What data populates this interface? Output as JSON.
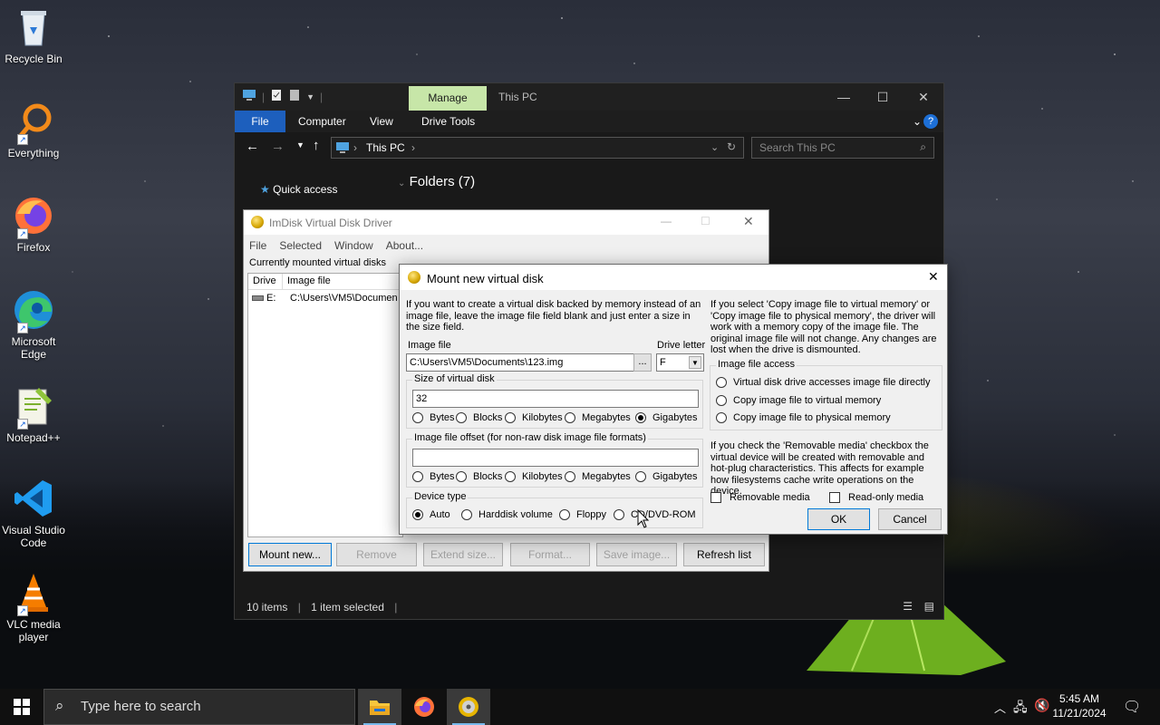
{
  "desktop": {
    "icons": [
      {
        "label": "Recycle Bin",
        "icon": "recycle-bin-icon"
      },
      {
        "label": "Everything",
        "icon": "everything-search-icon"
      },
      {
        "label": "Firefox",
        "icon": "firefox-icon"
      },
      {
        "label": "Microsoft Edge",
        "icon": "edge-icon"
      },
      {
        "label": "Notepad++",
        "icon": "notepadpp-icon"
      },
      {
        "label": "Visual Studio Code",
        "icon": "vscode-icon"
      },
      {
        "label": "VLC media player",
        "icon": "vlc-icon"
      }
    ]
  },
  "explorer": {
    "manage_tab": "Manage",
    "title": "This PC",
    "tabs": [
      "File",
      "Computer",
      "View",
      "Drive Tools"
    ],
    "address": "This PC",
    "search_placeholder": "Search This PC",
    "quick_access": "Quick access",
    "folders_heading": "Folders (7)",
    "status_items": "10 items",
    "status_selected": "1 item selected"
  },
  "imdisk": {
    "title": "ImDisk Virtual Disk Driver",
    "menu": [
      "File",
      "Selected",
      "Window",
      "About..."
    ],
    "mounted_label": "Currently mounted virtual disks",
    "columns": [
      "Drive",
      "Image file"
    ],
    "rows": [
      {
        "drive": "E:",
        "image": "C:\\Users\\VM5\\Documen"
      }
    ],
    "buttons": {
      "mount": "Mount new...",
      "remove": "Remove",
      "extend": "Extend size...",
      "format": "Format...",
      "save": "Save image...",
      "refresh": "Refresh list"
    }
  },
  "mount_dialog": {
    "title": "Mount new virtual disk",
    "intro": "If you want to create a virtual disk backed by memory instead of an image file, leave the image file field blank and just enter a size in the size field.",
    "image_file_label": "Image file",
    "image_file_value": "C:\\Users\\VM5\\Documents\\123.img",
    "browse_label": "...",
    "drive_letter_label": "Drive letter",
    "drive_letter_value": "F",
    "size_group": "Size of virtual disk",
    "size_value": "32",
    "size_units": [
      "Bytes",
      "Blocks",
      "Kilobytes",
      "Megabytes",
      "Gigabytes"
    ],
    "size_unit_selected": "Gigabytes",
    "offset_group": "Image file offset (for non-raw disk image file formats)",
    "offset_value": "",
    "offset_units": [
      "Bytes",
      "Blocks",
      "Kilobytes",
      "Megabytes",
      "Gigabytes"
    ],
    "device_group": "Device type",
    "device_types": [
      "Auto",
      "Harddisk volume",
      "Floppy",
      "CD/DVD-ROM"
    ],
    "device_selected": "Auto",
    "copy_note": "If you select 'Copy image file to virtual memory' or 'Copy image file to physical memory', the driver will work with a memory copy of the image file. The original image file will not change. Any changes are lost when the drive is dismounted.",
    "access_group": "Image file access",
    "access_options": [
      "Virtual disk drive accesses image file directly",
      "Copy image file to virtual memory",
      "Copy image file to physical memory"
    ],
    "removable_note": "If you check the 'Removable media' checkbox the virtual device will be created with removable and hot-plug characteristics. This affects for example how filesystems cache write operations on the device.",
    "removable_label": "Removable media",
    "readonly_label": "Read-only media",
    "ok_label": "OK",
    "cancel_label": "Cancel"
  },
  "taskbar": {
    "search_placeholder": "Type here to search",
    "time": "5:45 AM",
    "date": "11/21/2024"
  }
}
